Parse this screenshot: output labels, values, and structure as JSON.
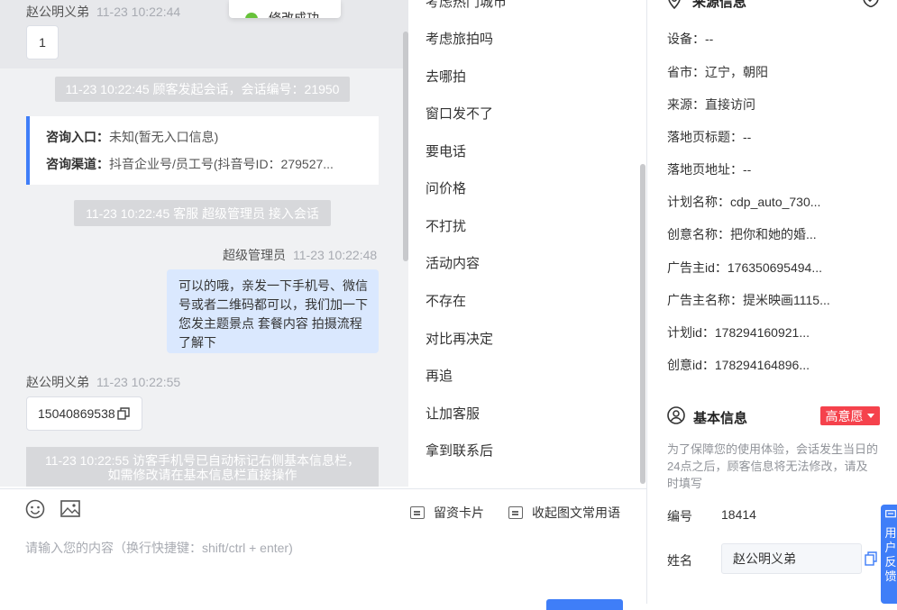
{
  "toast": {
    "text": "修改成功"
  },
  "chat": {
    "visitor_name": "赵公明义弟",
    "visitor_time_1": "11-23 10:22:44",
    "visitor_msg_1": "1",
    "sys_session_start": "11-23 10:22:45 顾客发起会话，会话编号：21950",
    "consult_entry_label": "咨询入口：",
    "consult_entry_value": "未知(暂无入口信息)",
    "consult_channel_label": "咨询渠道：",
    "consult_channel_value": "抖音企业号/员工号(抖音号ID：279527...",
    "sys_agent_join": "11-23 10:22:45 客服 超级管理员 接入会话",
    "agent_name": "超级管理员",
    "agent_time": "11-23 10:22:48",
    "agent_msg": "可以的哦，亲发一下手机号、微信号或者二维码都可以，我们加一下您发主题景点 套餐内容 拍摄流程了解下",
    "visitor_time_2": "11-23 10:22:55",
    "visitor_phone": "15040869538",
    "notice_line_1": "11-23 10:22:55 访客手机号已自动标记右侧基本信息栏，",
    "notice_line_2": "如需修改请在基本信息栏直接操作"
  },
  "quick_replies": [
    "考虑热门城市",
    "考虑旅拍吗",
    "去哪拍",
    "窗口发不了",
    "要电话",
    "问价格",
    "不打扰",
    "活动内容",
    "不存在",
    "对比再决定",
    "再追",
    "让加客服",
    "拿到联系后"
  ],
  "composer": {
    "card_label": "留资卡片",
    "collapse_label": "收起图文常用语",
    "placeholder": "请输入您的内容（换行快捷键：shift/ctrl + enter)"
  },
  "source_info": {
    "title": "来源信息",
    "fields": [
      "设备：--",
      "省市：辽宁，朝阳",
      "来源：直接访问",
      "落地页标题：--",
      "落地页地址：--",
      "计划名称：cdp_auto_730...",
      "创意名称：把你和她的婚...",
      "广告主id：176350695494...",
      "广告主名称：提米映画1115...",
      "计划id：178294160921...",
      "创意id：178294164896..."
    ]
  },
  "basic_info": {
    "title": "基本信息",
    "intent_badge": "高意愿",
    "hint": "为了保障您的使用体验，会话发生当日的24点之后，顾客信息将无法修改，请及时填写",
    "id_label": "编号",
    "id_value": "18414",
    "name_label": "姓名",
    "name_value": "赵公明义弟"
  },
  "feedback": {
    "label": "用户反馈"
  },
  "colors": {
    "accent": "#3f7ef8",
    "badge_red": "#f5424c",
    "agent_bubble": "#dae8fe"
  }
}
